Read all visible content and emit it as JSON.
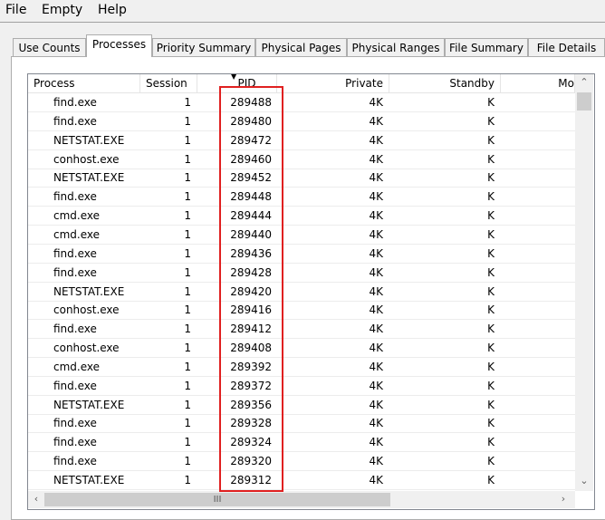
{
  "menu": [
    "File",
    "Empty",
    "Help"
  ],
  "tabs": [
    "Use Counts",
    "Processes",
    "Priority Summary",
    "Physical Pages",
    "Physical Ranges",
    "File Summary",
    "File Details"
  ],
  "active_tab": "Processes",
  "columns": [
    "Process",
    "Session",
    "PID",
    "Private",
    "Standby",
    "Mo"
  ],
  "sorted_column": "PID",
  "highlight_color": "#e02020",
  "rows": [
    [
      "find.exe",
      "1",
      "289488",
      "4K",
      "K"
    ],
    [
      "find.exe",
      "1",
      "289480",
      "4K",
      "K"
    ],
    [
      "NETSTAT.EXE",
      "1",
      "289472",
      "4K",
      "K"
    ],
    [
      "conhost.exe",
      "1",
      "289460",
      "4K",
      "K"
    ],
    [
      "NETSTAT.EXE",
      "1",
      "289452",
      "4K",
      "K"
    ],
    [
      "find.exe",
      "1",
      "289448",
      "4K",
      "K"
    ],
    [
      "cmd.exe",
      "1",
      "289444",
      "4K",
      "K"
    ],
    [
      "cmd.exe",
      "1",
      "289440",
      "4K",
      "K"
    ],
    [
      "find.exe",
      "1",
      "289436",
      "4K",
      "K"
    ],
    [
      "find.exe",
      "1",
      "289428",
      "4K",
      "K"
    ],
    [
      "NETSTAT.EXE",
      "1",
      "289420",
      "4K",
      "K"
    ],
    [
      "conhost.exe",
      "1",
      "289416",
      "4K",
      "K"
    ],
    [
      "find.exe",
      "1",
      "289412",
      "4K",
      "K"
    ],
    [
      "conhost.exe",
      "1",
      "289408",
      "4K",
      "K"
    ],
    [
      "cmd.exe",
      "1",
      "289392",
      "4K",
      "K"
    ],
    [
      "find.exe",
      "1",
      "289372",
      "4K",
      "K"
    ],
    [
      "NETSTAT.EXE",
      "1",
      "289356",
      "4K",
      "K"
    ],
    [
      "find.exe",
      "1",
      "289328",
      "4K",
      "K"
    ],
    [
      "find.exe",
      "1",
      "289324",
      "4K",
      "K"
    ],
    [
      "find.exe",
      "1",
      "289320",
      "4K",
      "K"
    ],
    [
      "NETSTAT.EXE",
      "1",
      "289312",
      "4K",
      "K"
    ]
  ]
}
